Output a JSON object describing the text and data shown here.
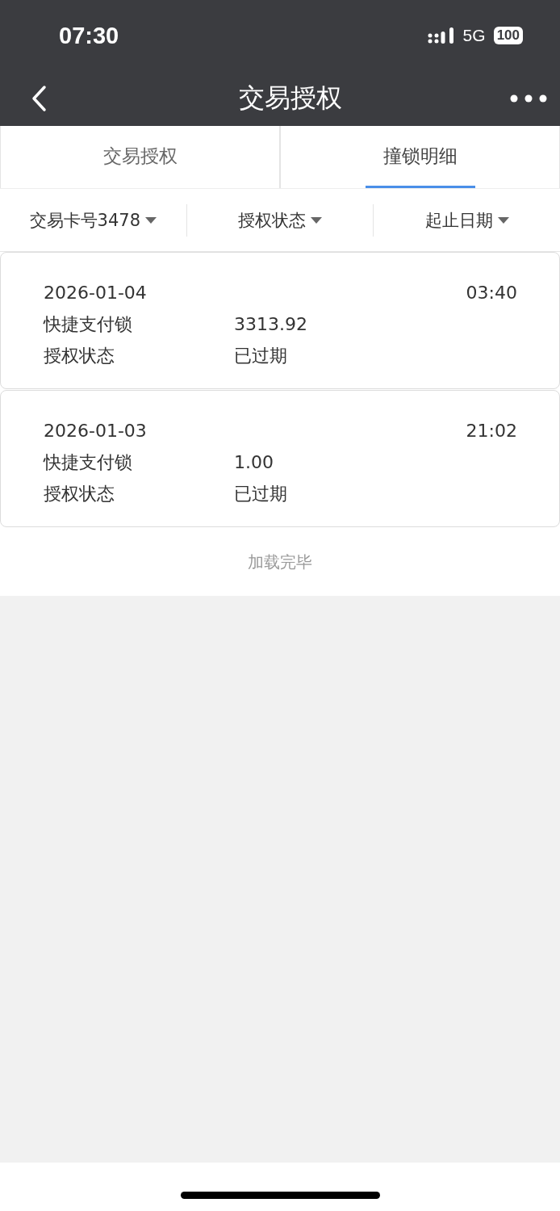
{
  "status_bar": {
    "time": "07:30",
    "network": "5G",
    "battery": "100"
  },
  "nav": {
    "title": "交易授权"
  },
  "tabs": [
    {
      "label": "交易授权",
      "selected": false
    },
    {
      "label": "撞锁明细",
      "selected": true
    }
  ],
  "filters": [
    {
      "label": "交易卡号3478"
    },
    {
      "label": "授权状态"
    },
    {
      "label": "起止日期"
    }
  ],
  "records": [
    {
      "date": "2026-01-04",
      "time": "03:40",
      "rows": [
        {
          "label": "快捷支付锁",
          "value": "3313.92"
        },
        {
          "label": "授权状态",
          "value": "已过期"
        }
      ]
    },
    {
      "date": "2026-01-03",
      "time": "21:02",
      "rows": [
        {
          "label": "快捷支付锁",
          "value": "1.00"
        },
        {
          "label": "授权状态",
          "value": "已过期"
        }
      ]
    }
  ],
  "footer": "加载完毕"
}
